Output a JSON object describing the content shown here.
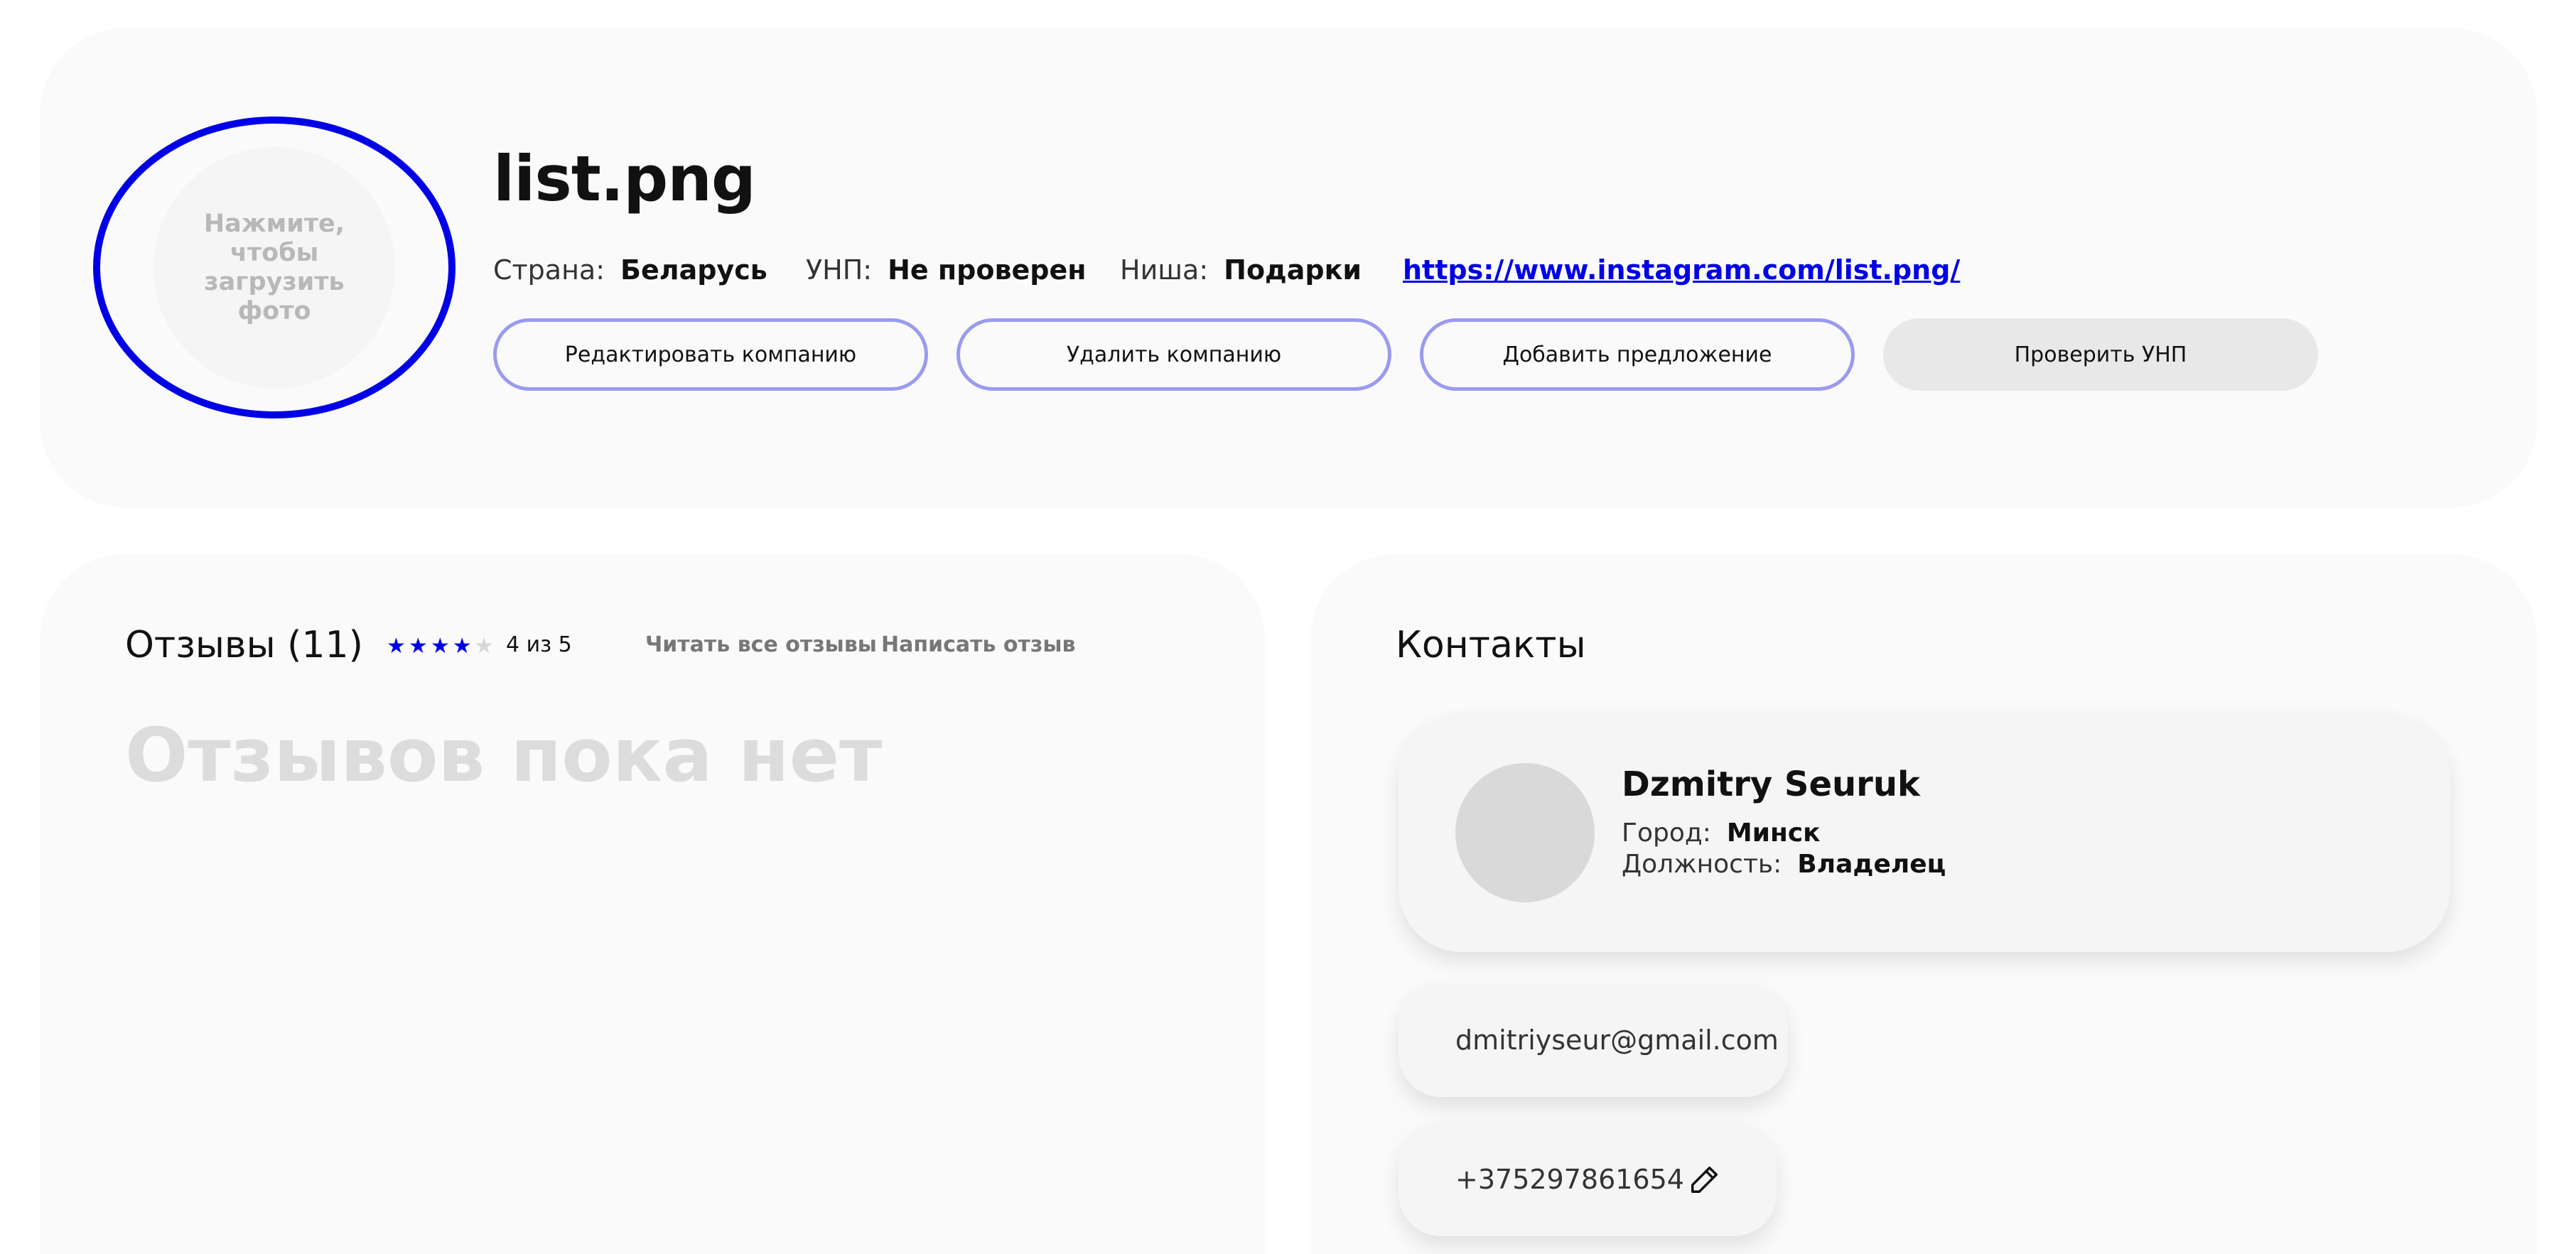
{
  "company": {
    "photo_prompt": "Нажмите, чтобы загрузить фото",
    "name": "list.png",
    "country_label": "Страна:",
    "country_value": "Беларусь",
    "unp_label": "УНП:",
    "unp_value": "Не проверен",
    "niche_label": "Ниша:",
    "niche_value": "Подарки",
    "link": "https://www.instagram.com/list.png/",
    "buttons": {
      "edit": "Редактировать компанию",
      "delete": "Удалить компанию",
      "add_offer": "Добавить предложение",
      "check_unp": "Проверить УНП"
    }
  },
  "reviews": {
    "title": "Отзывы (11)",
    "rating": 4,
    "rating_max": 5,
    "rating_text": "4 из 5",
    "read_all": "Читать все отзывы",
    "write": "Написать отзыв",
    "empty_text": "Отзывов пока нет"
  },
  "contacts": {
    "title": "Контакты",
    "person": {
      "name": "Dzmitry Seuruk",
      "city_label": "Город:",
      "city_value": "Минск",
      "role_label": "Должность:",
      "role_value": "Владелец"
    },
    "email": "dmitriyseur@gmail.com",
    "phone": "+375297861654"
  },
  "colors": {
    "accent": "#0000e6",
    "button_border": "#9a9af0",
    "card_bg": "#fafafa",
    "muted_text": "#dcdcdc"
  },
  "icons": {
    "phone_edit": "pencil-icon"
  }
}
